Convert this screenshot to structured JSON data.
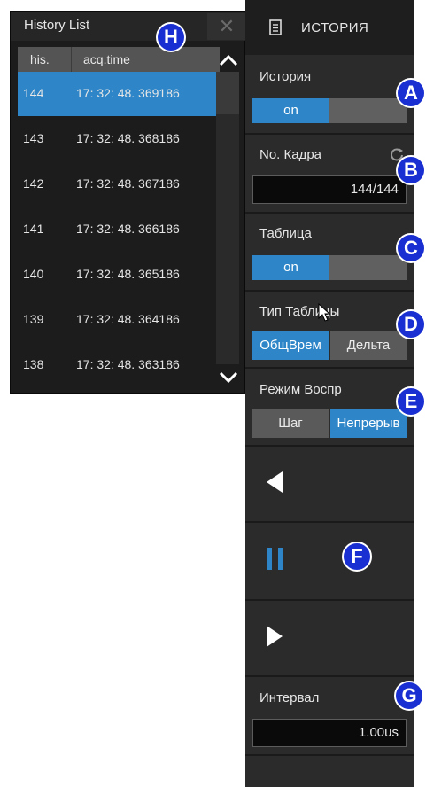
{
  "history_list": {
    "title": "History List",
    "close_symbol": "✕",
    "columns": [
      "his.",
      "acq.time"
    ],
    "rows": [
      {
        "his": "144",
        "time": "17: 32: 48. 369186",
        "selected": true
      },
      {
        "his": "143",
        "time": "17: 32: 48. 368186"
      },
      {
        "his": "142",
        "time": "17: 32: 48. 367186"
      },
      {
        "his": "141",
        "time": "17: 32: 48. 366186"
      },
      {
        "his": "140",
        "time": "17: 32: 48. 365186"
      },
      {
        "his": "139",
        "time": "17: 32: 48. 364186"
      },
      {
        "his": "138",
        "time": "17: 32: 48. 363186"
      }
    ],
    "scroll_up_icon": "chevron-up-icon",
    "scroll_down_icon": "chevron-down-icon"
  },
  "menu": {
    "title": "ИСТОРИЯ",
    "title_icon": "document-icon",
    "history": {
      "label": "История",
      "value": "on"
    },
    "frame": {
      "label": "No. Кадра",
      "value": "144/144",
      "icon": "refresh-icon"
    },
    "table": {
      "label": "Таблица",
      "value": "on"
    },
    "table_type": {
      "label": "Тип Таблицы",
      "options": [
        "ОбщВрем",
        "Дельта"
      ],
      "selected": "ОбщВрем"
    },
    "playback_mode": {
      "label": "Режим Воспр",
      "options": [
        "Шаг",
        "Непрерыв"
      ],
      "selected": "Непрерыв"
    },
    "playback_controls": [
      "play-backward-icon",
      "pause-icon",
      "play-forward-icon"
    ],
    "interval": {
      "label": "Интервал",
      "value": "1.00us"
    }
  },
  "callouts": [
    "A",
    "B",
    "C",
    "D",
    "E",
    "F",
    "G",
    "H"
  ],
  "colors": {
    "accent": "#2e86c8",
    "panel_bg": "#2b2b2b",
    "badge": "#1a2fd1"
  }
}
